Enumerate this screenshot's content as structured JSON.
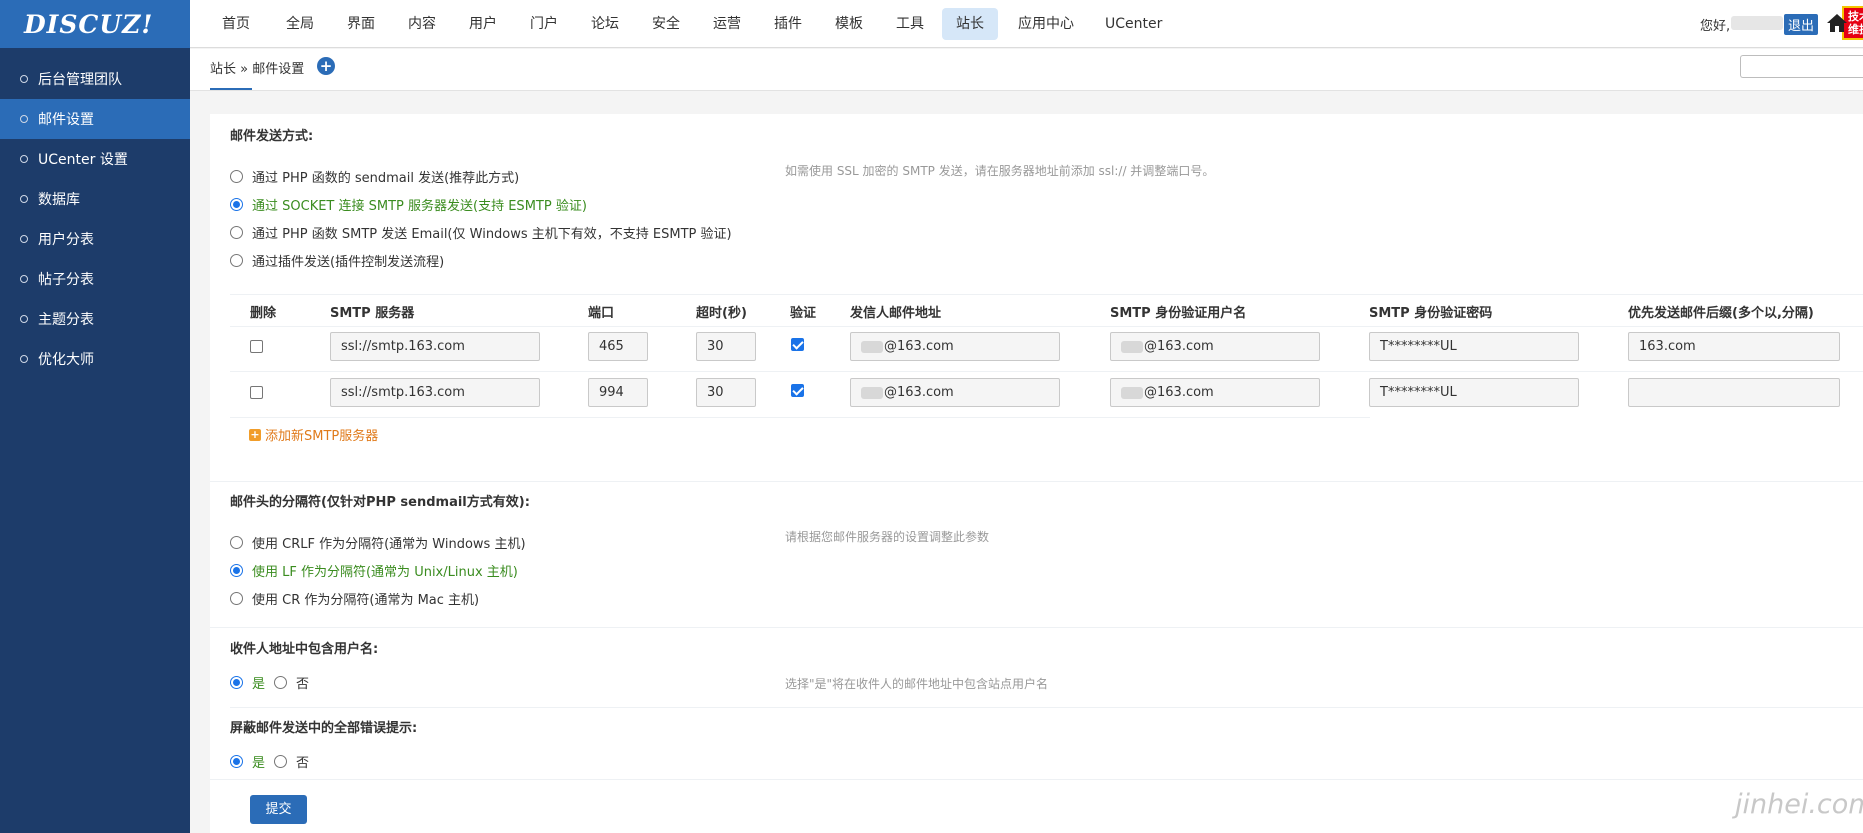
{
  "logo": {
    "text": "DISCUZ!"
  },
  "sidebar": {
    "items": [
      {
        "label": "后台管理团队"
      },
      {
        "label": "邮件设置"
      },
      {
        "label": "UCenter 设置"
      },
      {
        "label": "数据库"
      },
      {
        "label": "用户分表"
      },
      {
        "label": "帖子分表"
      },
      {
        "label": "主题分表"
      },
      {
        "label": "优化大师"
      }
    ],
    "active_index": 1
  },
  "topnav": {
    "items": [
      "首页",
      "全局",
      "界面",
      "内容",
      "用户",
      "门户",
      "论坛",
      "安全",
      "运营",
      "插件",
      "模板",
      "工具",
      "站长",
      "应用中心",
      "UCenter"
    ],
    "active": "站长",
    "badge": [
      "技术",
      "维护"
    ],
    "greeting": "您好,",
    "logout": "退出"
  },
  "breadcrumb": {
    "root": "站长",
    "sep": " » ",
    "current": "邮件设置",
    "add_icon": "+"
  },
  "mail_method": {
    "title": "邮件发送方式:",
    "options": [
      "通过 PHP 函数的 sendmail 发送(推荐此方式)",
      "通过 SOCKET 连接 SMTP 服务器发送(支持 ESMTP 验证)",
      "通过 PHP 函数 SMTP 发送 Email(仅 Windows 主机下有效，不支持 ESMTP 验证)",
      "通过插件发送(插件控制发送流程)"
    ],
    "selected_index": 1,
    "hint": "如需使用 SSL 加密的 SMTP 发送，请在服务器地址前添加 ssl:// 并调整端口号。"
  },
  "smtp_table": {
    "headers": [
      "删除",
      "SMTP 服务器",
      "端口",
      "超时(秒)",
      "验证",
      "发信人邮件地址",
      "SMTP 身份验证用户名",
      "SMTP 身份验证密码",
      "优先发送邮件后缀(多个以,分隔)"
    ],
    "rows": [
      {
        "delete": false,
        "server": "ssl://smtp.163.com",
        "port": "465",
        "timeout": "30",
        "auth": true,
        "from": "@163.com",
        "username": "@163.com",
        "password": "T********UL",
        "suffix": "163.com"
      },
      {
        "delete": false,
        "server": "ssl://smtp.163.com",
        "port": "994",
        "timeout": "30",
        "auth": true,
        "from": "@163.com",
        "username": "@163.com",
        "password": "T********UL",
        "suffix": ""
      }
    ],
    "add_label": "添加新SMTP服务器"
  },
  "separator": {
    "title": "邮件头的分隔符(仅针对PHP sendmail方式有效):",
    "options": [
      "使用 CRLF 作为分隔符(通常为 Windows 主机)",
      "使用 LF 作为分隔符(通常为 Unix/Linux 主机)",
      "使用 CR 作为分隔符(通常为 Mac 主机)"
    ],
    "selected_index": 1,
    "hint": "请根据您邮件服务器的设置调整此参数"
  },
  "include_username": {
    "title": "收件人地址中包含用户名:",
    "yes": "是",
    "no": "否",
    "selected": "yes",
    "hint": "选择\"是\"将在收件人的邮件地址中包含站点用户名"
  },
  "hide_errors": {
    "title": "屏蔽邮件发送中的全部错误提示:",
    "yes": "是",
    "no": "否",
    "selected": "yes"
  },
  "submit_label": "提交",
  "watermark": "jinhei.com",
  "colors": {
    "sidebar_bg": "#1d3c6a",
    "accent": "#2b6cb7",
    "selected_text": "#3a8c1f",
    "orange_link": "#e07a1a"
  }
}
